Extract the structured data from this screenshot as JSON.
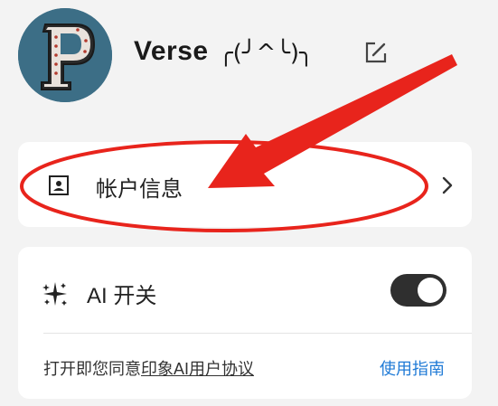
{
  "profile": {
    "avatar_icon": "letter-p-logo",
    "username": "Verse",
    "kaomoji": "╭(╯^╰)╮",
    "edit_icon": "edit-icon"
  },
  "account": {
    "icon": "account-card-icon",
    "label": "帐户信息",
    "chevron_icon": "chevron-right-icon"
  },
  "ai": {
    "icon": "sparkle-icon",
    "label": "AI 开关",
    "toggle_on": true,
    "agreement_prefix": "打开即您同意",
    "agreement_link": "印象AI用户协议",
    "guide_link": "使用指南"
  },
  "colors": {
    "background": "#f3f3f3",
    "card": "#ffffff",
    "toggle_on": "#2f2f2f",
    "link": "#1f7ad6",
    "annotation": "#e8241c"
  }
}
